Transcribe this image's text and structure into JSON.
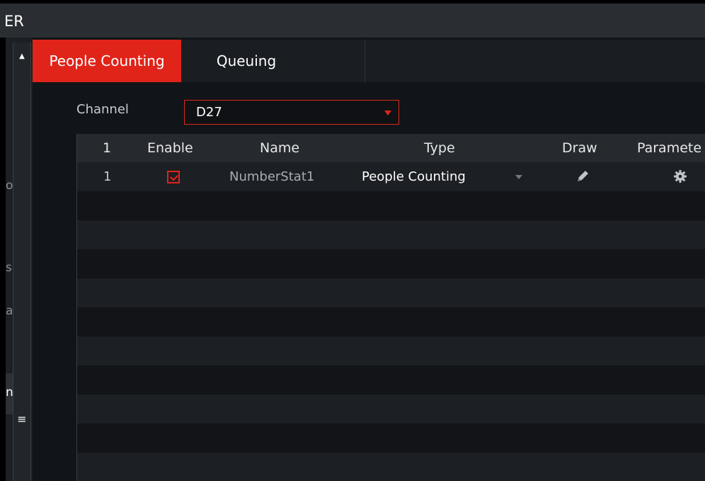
{
  "window": {
    "title": "ER"
  },
  "sidebar": {
    "fragments": [
      "o",
      "s",
      "a",
      "n:"
    ]
  },
  "tabs": [
    {
      "label": "People Counting",
      "active": true
    },
    {
      "label": "Queuing",
      "active": false
    }
  ],
  "channel": {
    "label": "Channel",
    "value": "D27"
  },
  "table": {
    "headers": [
      "1",
      "Enable",
      "Name",
      "Type",
      "Draw",
      "Paramete"
    ],
    "rows": [
      {
        "no": "1",
        "enabled": true,
        "name": "NumberStat1",
        "type": "People Counting",
        "draw_icon": "pencil-icon",
        "param_icon": "gear-icon"
      }
    ]
  },
  "colors": {
    "accent": "#e0241a",
    "titlebar": "#2a2e33",
    "header": "#26292d"
  }
}
